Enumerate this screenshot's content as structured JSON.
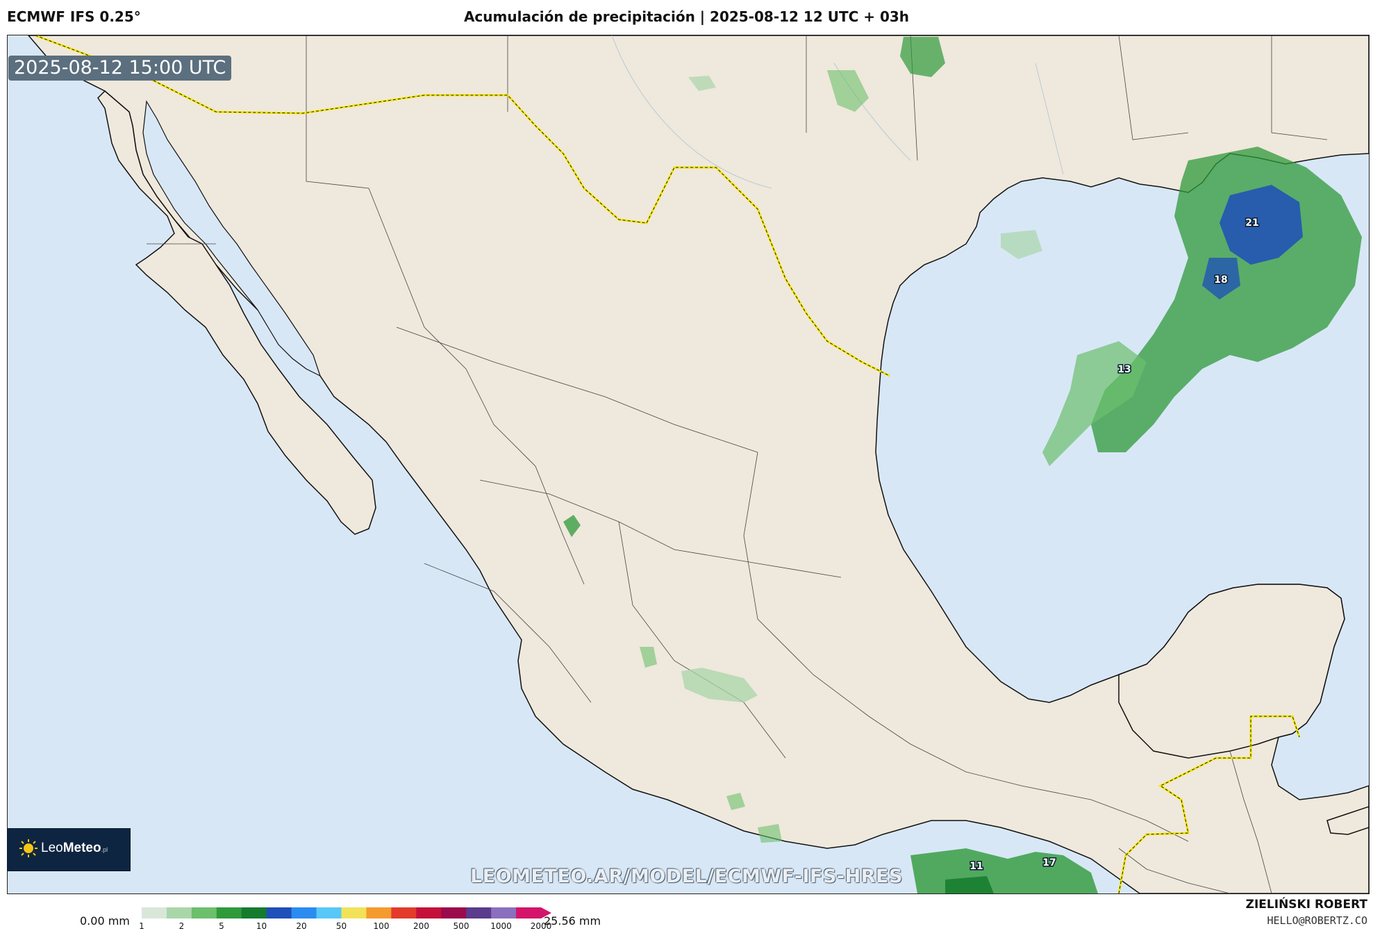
{
  "header": {
    "model": "ECMWF IFS 0.25°",
    "title": "Acumulación de precipitación | 2025-08-12 12 UTC + 03h"
  },
  "map": {
    "valid_time": "2025-08-12 15:00 UTC",
    "watermark": "LEOMETEO.AR/MODEL/ECMWF-IFS-HRES",
    "logo": {
      "name_light": "Leo",
      "name_bold": "Meteo",
      "suffix": ".pl"
    },
    "max_labels": [
      {
        "value": "21"
      },
      {
        "value": "18"
      },
      {
        "value": "13"
      },
      {
        "value": "11"
      },
      {
        "value": "17"
      }
    ],
    "colors": {
      "ocean": "#d8e7f6",
      "land": "#efe8dc",
      "border": "#f2e600"
    }
  },
  "colorbar": {
    "min_label": "0.00 mm",
    "max_label": "25.56 mm",
    "ticks": [
      "1",
      "2",
      "5",
      "10",
      "20",
      "50",
      "100",
      "200",
      "500",
      "1000",
      "2000"
    ],
    "colors": [
      "#d9e7d9",
      "#a9d6a9",
      "#6cbf6c",
      "#2f9a3a",
      "#157b2e",
      "#1f4fb8",
      "#2a8cf0",
      "#57c8f7",
      "#f2e25a",
      "#f59b2e",
      "#e23b2b",
      "#c4103a",
      "#9b0a4a",
      "#5a3b8c",
      "#8b6fbf",
      "#d4146a"
    ]
  },
  "footer": {
    "author": "ZIELIŃSKI ROBERT",
    "email": "HELLO@ROBERTZ.CO"
  }
}
